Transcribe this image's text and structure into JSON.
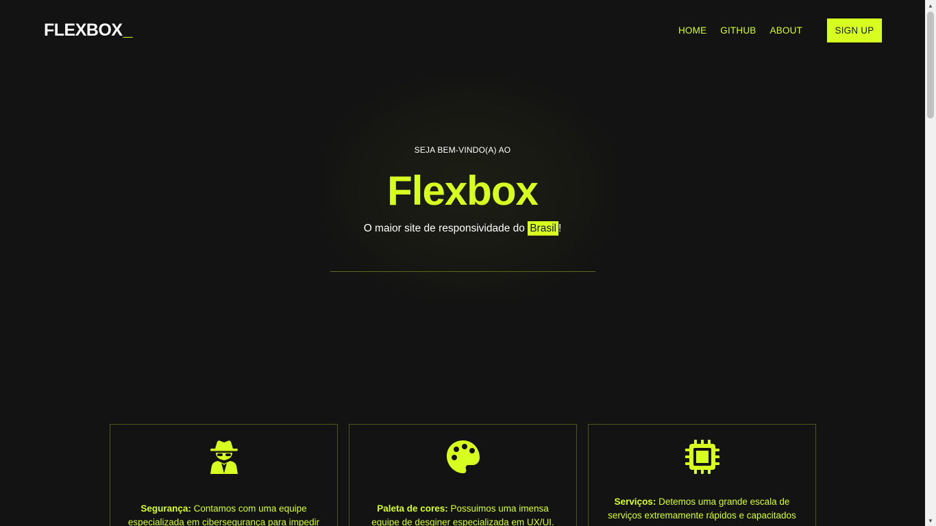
{
  "header": {
    "logo": "FLEXBOX",
    "logo_cursor": "_",
    "nav": [
      "HOME",
      "GITHUB",
      "ABOUT"
    ],
    "signup": "SIGN UP"
  },
  "hero": {
    "eyebrow": "SEJA BEM-VINDO(A) AO",
    "title": "Flexbox",
    "subtitle_before": "O maior site de responsividade do ",
    "subtitle_highlight": "Brasil",
    "subtitle_after": "!"
  },
  "cards": [
    {
      "icon": "spy-icon",
      "title": "Segurança:",
      "text": " Contamos com uma equipe especializada em cibersegurança para impedir"
    },
    {
      "icon": "palette-icon",
      "title": "Paleta de cores:",
      "text": " Possuimos uma imensa equipe de desginer especializada em UX/UI. Além disso,"
    },
    {
      "icon": "chip-icon",
      "title": "Serviços:",
      "text": " Detemos uma grande escala de serviços extremamente rápidos e capacitados"
    }
  ],
  "colors": {
    "accent": "#d7ff1f",
    "background": "#131313"
  }
}
